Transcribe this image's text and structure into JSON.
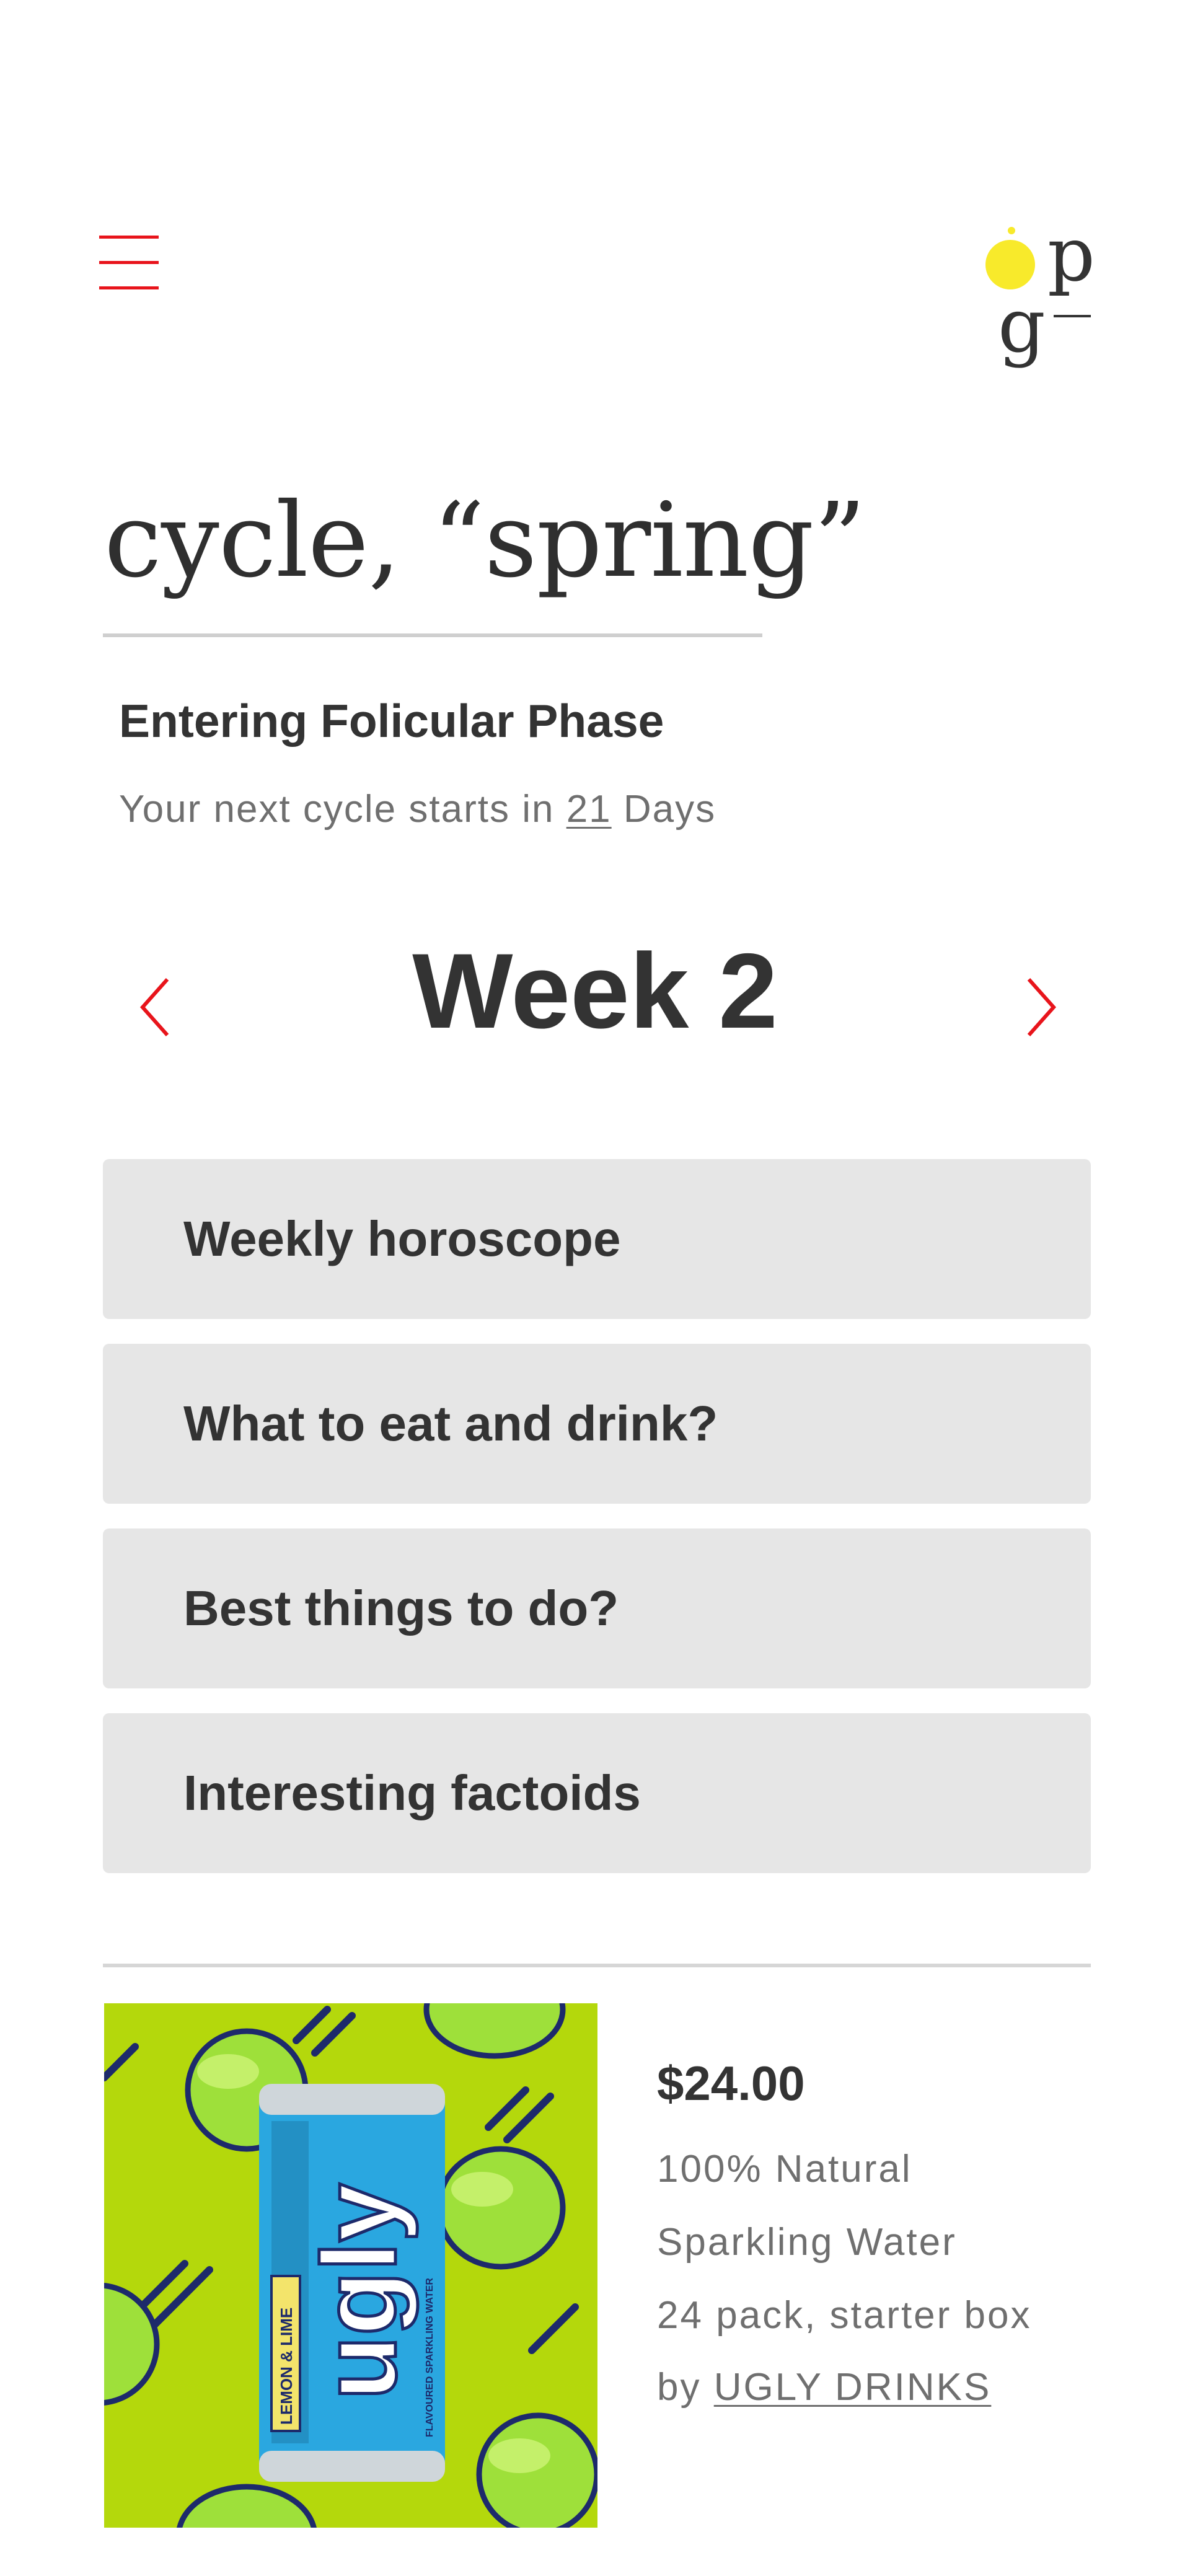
{
  "header": {
    "menu_icon": "hamburger-menu-icon",
    "logo_letters": [
      "p",
      "g"
    ],
    "accent_color": "#e8141b",
    "logo_dot_color": "#f8ea2b"
  },
  "cycle": {
    "title": "cycle, “spring”",
    "phase": "Entering Folicular Phase",
    "next_prefix": "Your next cycle starts in ",
    "next_days": "21",
    "next_suffix": " Days"
  },
  "week": {
    "label": "Week 2",
    "prev_icon": "chevron-left-icon",
    "next_icon": "chevron-right-icon"
  },
  "sections": [
    {
      "label": "Weekly horoscope"
    },
    {
      "label": "What to eat and drink?"
    },
    {
      "label": "Best things to do?"
    },
    {
      "label": "Interesting factoids"
    }
  ],
  "product": {
    "price": "$24.00",
    "desc_line1": "100% Natural",
    "desc_line2": "Sparkling Water",
    "desc_line3": "24 pack, starter box",
    "by_prefix": "by ",
    "brand": "UGLY DRINKS",
    "can_text": "ugly",
    "can_side_label": "LEMON & LIME",
    "can_small_text": "FLAVOURED SPARKLING WATER",
    "image_bg_color": "#b4d80c"
  }
}
